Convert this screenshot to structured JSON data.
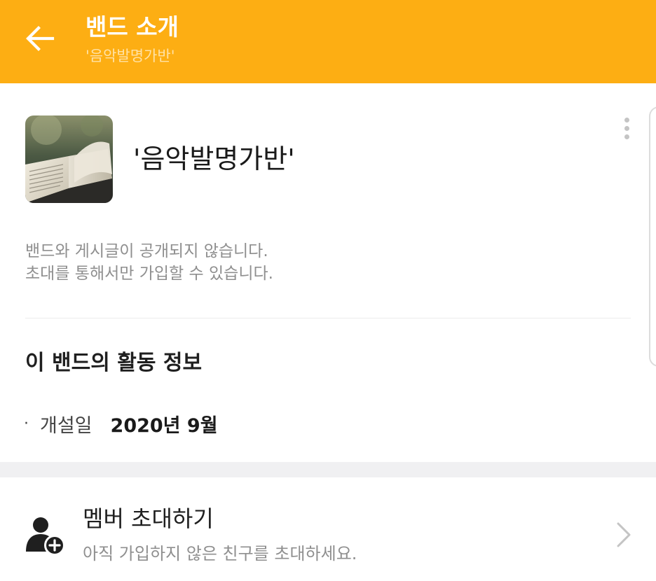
{
  "header": {
    "title": "밴드 소개",
    "subtitle": "'음악발명가반'",
    "background_color": "#FDAE13",
    "back_icon": "arrow-left-icon"
  },
  "band": {
    "name": "'음악발명가반'",
    "cover_icon": "open-book-photo",
    "more_icon": "more-vertical-icon",
    "privacy_line1": "밴드와 게시글이 공개되지 않습니다.",
    "privacy_line2": "초대를 통해서만 가입할 수 있습니다."
  },
  "activity": {
    "title": "이 밴드의 활동 정보",
    "bullet": "·",
    "founded_label": "개설일",
    "founded_value": "2020년 9월"
  },
  "invite": {
    "title": "멤버 초대하기",
    "description": "아직 가입하지 않은 친구를 초대하세요.",
    "icon": "add-user-icon",
    "chevron_icon": "chevron-right-icon"
  }
}
